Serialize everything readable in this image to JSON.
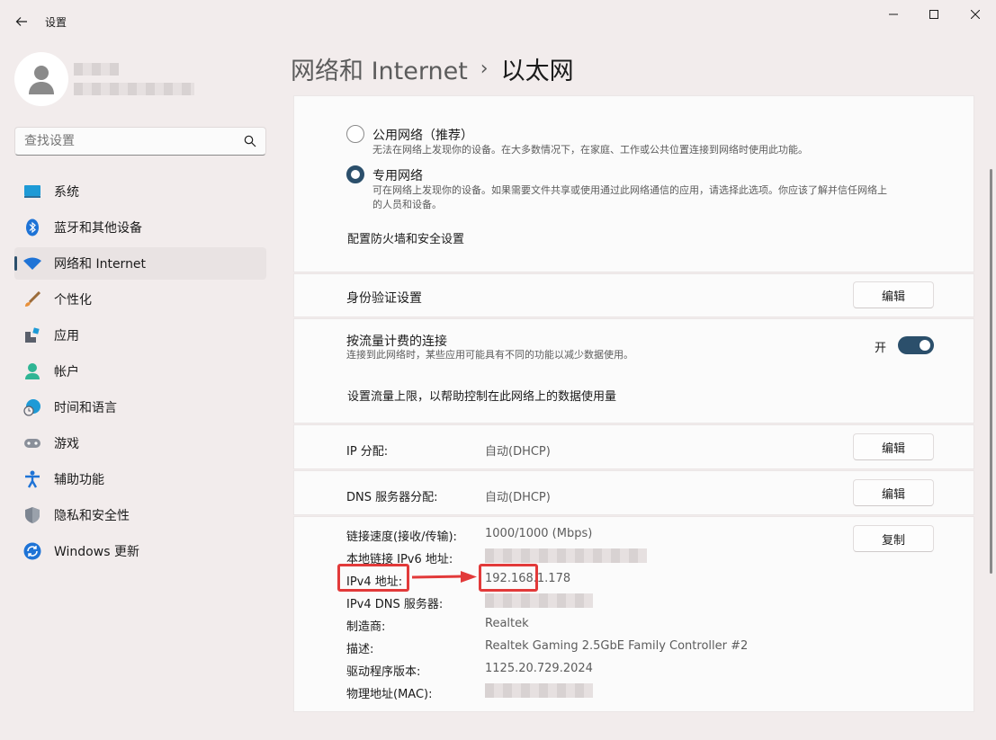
{
  "window": {
    "title": "设置",
    "minimize_glyph": "—",
    "maximize_glyph": "☐",
    "close_glyph": "✕"
  },
  "search": {
    "placeholder": "查找设置"
  },
  "sidebar": {
    "items": [
      {
        "label": "系统",
        "icon": "system-icon"
      },
      {
        "label": "蓝牙和其他设备",
        "icon": "bluetooth-icon"
      },
      {
        "label": "网络和 Internet",
        "icon": "wifi-icon",
        "active": true
      },
      {
        "label": "个性化",
        "icon": "brush-icon"
      },
      {
        "label": "应用",
        "icon": "apps-icon"
      },
      {
        "label": "帐户",
        "icon": "account-icon"
      },
      {
        "label": "时间和语言",
        "icon": "globe-clock-icon"
      },
      {
        "label": "游戏",
        "icon": "gamepad-icon"
      },
      {
        "label": "辅助功能",
        "icon": "accessibility-icon"
      },
      {
        "label": "隐私和安全性",
        "icon": "shield-icon"
      },
      {
        "label": "Windows 更新",
        "icon": "update-icon"
      }
    ]
  },
  "header": {
    "parent": "网络和 Internet",
    "separator": "›",
    "current": "以太网"
  },
  "network_profile": {
    "public": {
      "label": "公用网络（推荐）",
      "desc": "无法在网络上发现你的设备。在大多数情况下，在家庭、工作或公共位置连接到网络时使用此功能。"
    },
    "private": {
      "label": "专用网络",
      "desc_line1": "可在网络上发现你的设备。如果需要文件共享或使用通过此网络通信的应用，请选择此选项。你应该了解并信任网络上",
      "desc_line2": "的人员和设备。"
    },
    "firewall_link": "配置防火墙和安全设置"
  },
  "auth": {
    "label": "身份验证设置",
    "button": "编辑"
  },
  "metered": {
    "label": "按流量计费的连接",
    "desc": "连接到此网络时，某些应用可能具有不同的功能以减少数据使用。",
    "state": "开",
    "data_limit_link": "设置流量上限，以帮助控制在此网络上的数据使用量"
  },
  "ip": {
    "label": "IP 分配:",
    "value": "自动(DHCP)",
    "button": "编辑"
  },
  "dns": {
    "label": "DNS 服务器分配:",
    "value": "自动(DHCP)",
    "button": "编辑"
  },
  "properties": {
    "copy_button": "复制",
    "link_speed_label": "链接速度(接收/传输):",
    "link_speed_value": "1000/1000 (Mbps)",
    "ipv6_label": "本地链接 IPv6 地址:",
    "ipv4_label": "IPv4 地址:",
    "ipv4_value": "192.168.1.178",
    "ipv4_dns_label": "IPv4 DNS 服务器:",
    "manufacturer_label": "制造商:",
    "manufacturer_value": "Realtek",
    "description_label": "描述:",
    "description_value": "Realtek Gaming 2.5GbE Family Controller #2",
    "driver_label": "驱动程序版本:",
    "driver_value": "1125.20.729.2024",
    "mac_label": "物理地址(MAC):"
  },
  "colors": {
    "accent": "#2b4f6b",
    "annotation": "#e23a3a"
  }
}
